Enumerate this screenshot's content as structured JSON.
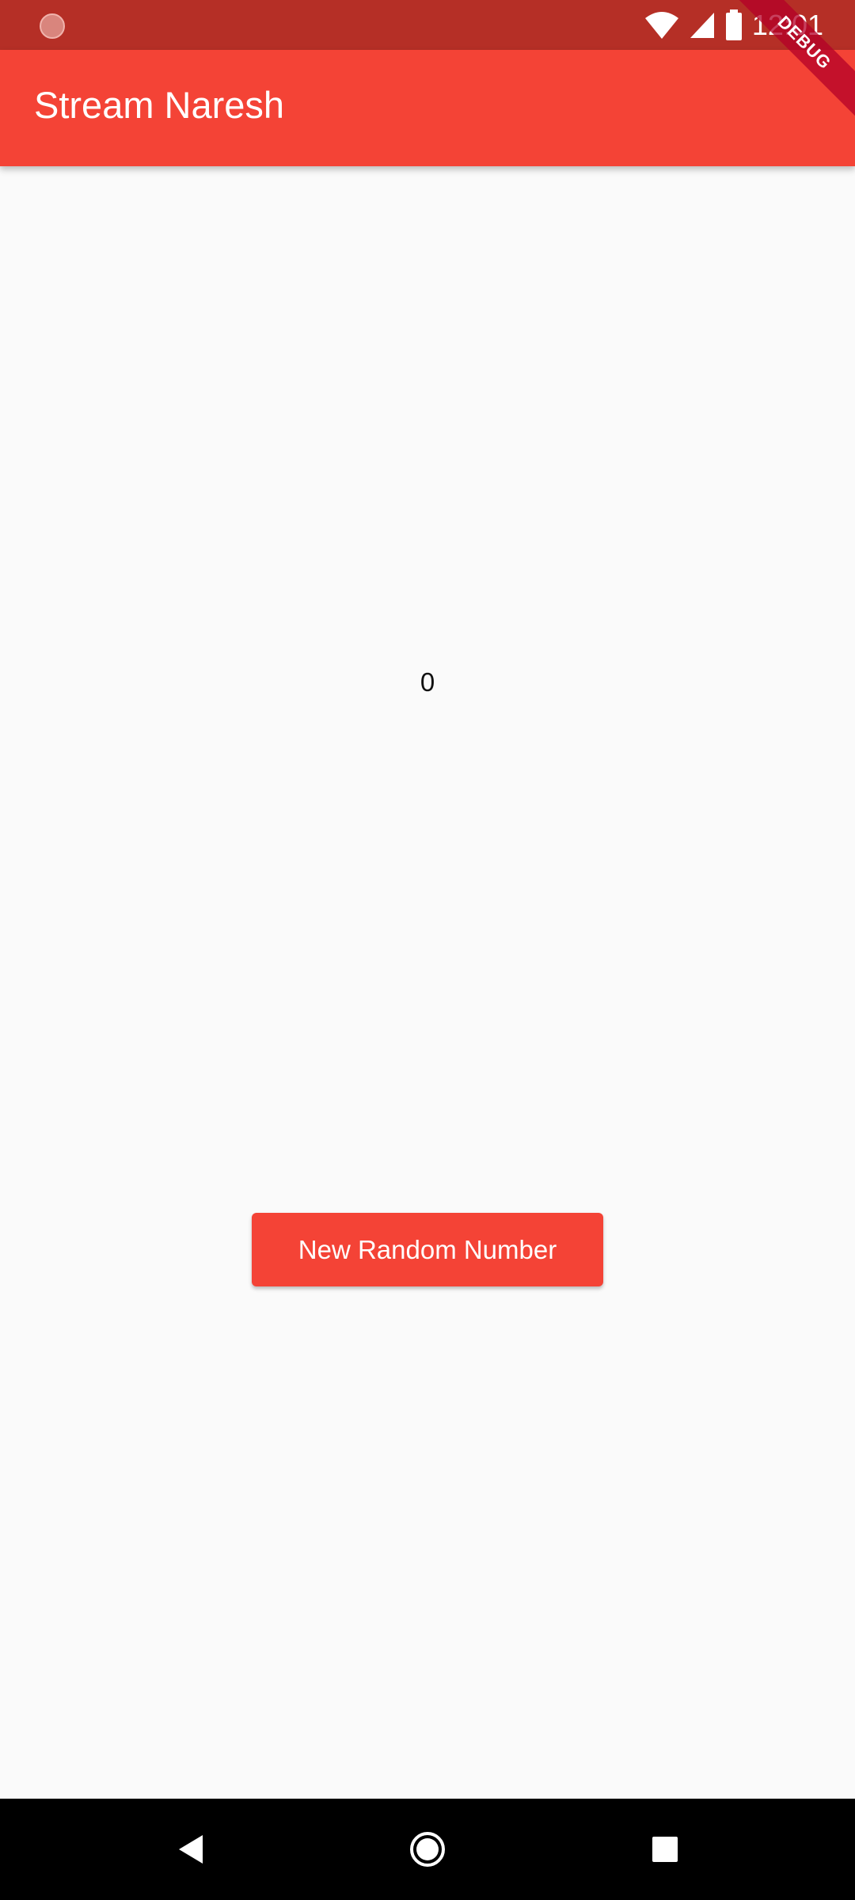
{
  "status_bar": {
    "time": "12:01",
    "icons": [
      "notification-dot-icon",
      "wifi-icon",
      "signal-icon",
      "battery-icon"
    ],
    "background_color": "#b52f26"
  },
  "app_bar": {
    "title": "Stream Naresh",
    "background_color": "#f44336"
  },
  "debug_banner": {
    "label": "DEBUG"
  },
  "main": {
    "counter_value": "0",
    "button_label": "New Random Number"
  },
  "nav_bar": {
    "icons": [
      "back-icon",
      "home-icon",
      "recents-icon"
    ]
  }
}
